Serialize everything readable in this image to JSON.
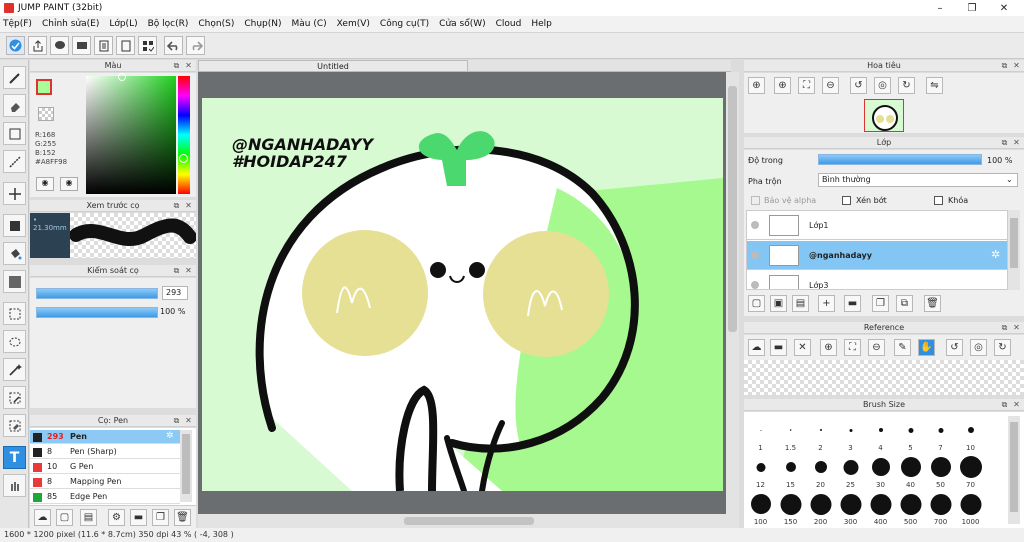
{
  "window": {
    "title": "JUMP PAINT (32bit)",
    "minimize": "–",
    "restore": "❐",
    "close": "✕"
  },
  "menu": [
    "Tệp(F)",
    "Chỉnh sửa(E)",
    "Lớp(L)",
    "Bộ lọc(R)",
    "Chọn(S)",
    "Chụp(N)",
    "Màu (C)",
    "Xem(V)",
    "Công cụ(T)",
    "Cửa sổ(W)",
    "Cloud",
    "Help"
  ],
  "color_panel": {
    "title": "Màu",
    "r": "R:168",
    "g": "G:255",
    "b": "B:152",
    "hex": "#A8FF98",
    "fg": "#a8ff98"
  },
  "brush_preview": {
    "title": "Xem trước cọ",
    "size": "21.30mm"
  },
  "brush_control": {
    "title": "Kiểm soát cọ",
    "size_value": "293",
    "opacity_value": "100 %"
  },
  "brush_list": {
    "title": "Cọ: Pen",
    "items": [
      {
        "num": "293",
        "name": "Pen",
        "color": "#222222",
        "selected": true
      },
      {
        "num": "8",
        "name": "Pen (Sharp)",
        "color": "#222222",
        "selected": false
      },
      {
        "num": "10",
        "name": "G Pen",
        "color": "#e83a3a",
        "selected": false
      },
      {
        "num": "8",
        "name": "Mapping Pen",
        "color": "#e83a3a",
        "selected": false
      },
      {
        "num": "85",
        "name": "Edge Pen",
        "color": "#1fa83a",
        "selected": false
      }
    ]
  },
  "canvas": {
    "tab": "Untitled",
    "text1": "@NGANHADAYY",
    "text2": "#HOIDAP247"
  },
  "navigator": {
    "title": "Hoa tiêu"
  },
  "layers": {
    "title": "Lớp",
    "opacity_label": "Độ trong",
    "opacity_value": "100 %",
    "opacity_fraction": 1.0,
    "blend_label": "Pha trộn",
    "blend_value": "Bình thường",
    "protect_alpha": "Bảo vệ alpha",
    "clipping": "Xén bớt",
    "lock": "Khóa",
    "items": [
      {
        "name": "Lớp1",
        "selected": false
      },
      {
        "name": "@nganhadayy",
        "selected": true
      },
      {
        "name": "Lớp3",
        "selected": false
      }
    ]
  },
  "reference": {
    "title": "Reference"
  },
  "brush_size": {
    "title": "Brush Size",
    "sizes": [
      "1",
      "1.5",
      "2",
      "3",
      "4",
      "5",
      "7",
      "10",
      "12",
      "15",
      "20",
      "25",
      "30",
      "40",
      "50",
      "70",
      "100",
      "150",
      "200",
      "300",
      "400",
      "500",
      "700",
      "1000"
    ]
  },
  "status": "1600 * 1200 pixel  (11.6 * 8.7cm)  350 dpi  43 %  ( -4, 308 )"
}
